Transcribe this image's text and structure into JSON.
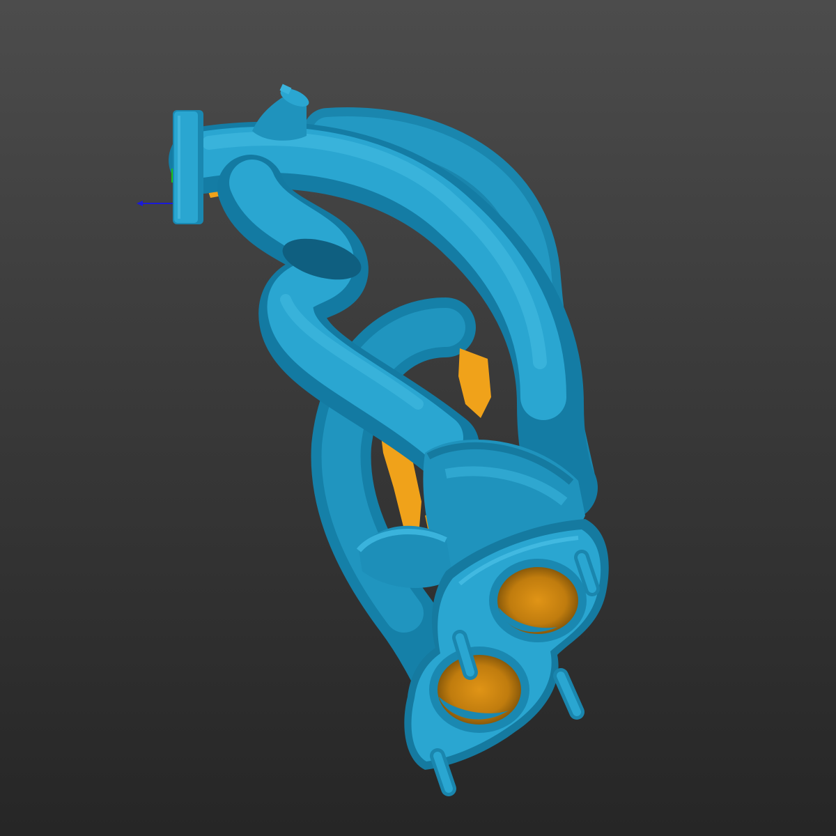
{
  "viewport": {
    "background_top": "#4c4c4c",
    "background_bottom": "#262626"
  },
  "model": {
    "object": "exhaust-manifest-scan",
    "surface_color": "#2aa6d1",
    "surface_shadow": "#157aa0",
    "surface_highlight": "#52c2e6",
    "deviation_color": "#f0a21a",
    "deviation_shadow": "#b9760c"
  },
  "axis_gizmo": {
    "x_axis_color": "#1a1ad8",
    "y_axis_color": "#18c018"
  }
}
